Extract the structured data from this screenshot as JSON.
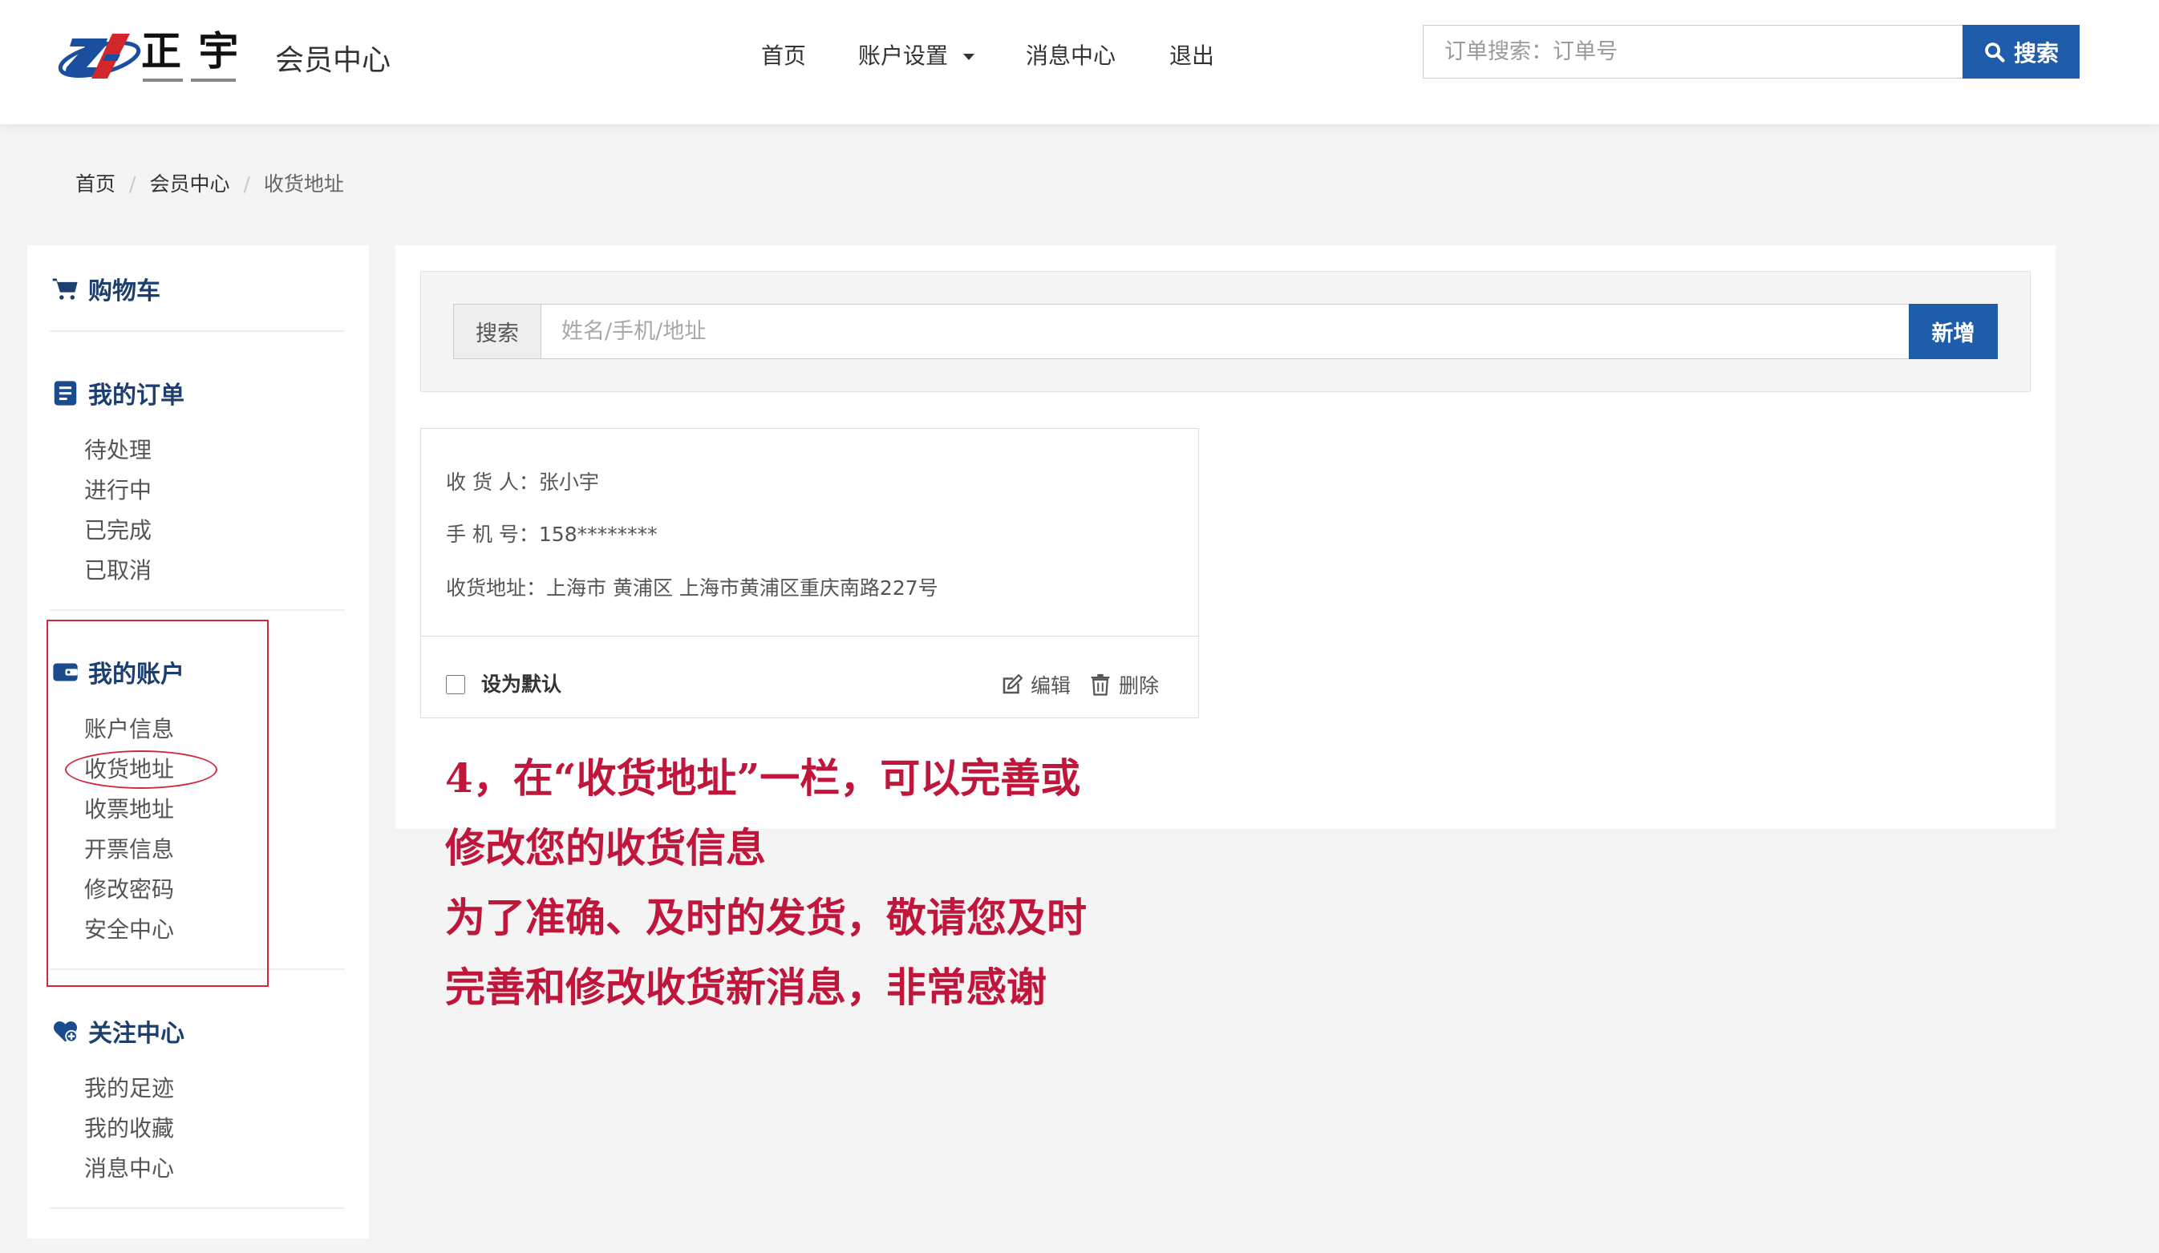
{
  "header": {
    "logo_text": "正 宇",
    "title": "会员中心",
    "nav": [
      {
        "label": "首页"
      },
      {
        "label": "账户设置",
        "icon": "caret-down-icon"
      },
      {
        "label": "消息中心"
      },
      {
        "label": "退出"
      }
    ],
    "search_placeholder": "订单搜索：订单号",
    "search_button": "搜索",
    "search_icon": "search-icon"
  },
  "breadcrumb": [
    "首页",
    "会员中心",
    "收货地址"
  ],
  "sidebar": {
    "sections": [
      {
        "title": "购物车",
        "icon": "cart-icon",
        "items": []
      },
      {
        "title": "我的订单",
        "icon": "order-icon",
        "items": [
          "待处理",
          "进行中",
          "已完成",
          "已取消"
        ]
      },
      {
        "title": "我的账户",
        "icon": "wallet-icon",
        "items": [
          "账户信息",
          "收货地址",
          "收票地址",
          "开票信息",
          "修改密码",
          "安全中心"
        ]
      },
      {
        "title": "关注中心",
        "icon": "heart-icon",
        "items": [
          "我的足迹",
          "我的收藏",
          "消息中心"
        ]
      }
    ],
    "highlighted_item": "收货地址"
  },
  "address_search": {
    "addon_label": "搜索",
    "placeholder": "姓名/手机/地址",
    "add_button": "新增"
  },
  "address_card": {
    "recipient_label": "收 货 人：",
    "recipient": "张小宇",
    "phone_label": "手 机 号：",
    "phone": "158********",
    "address_label": "收货地址：",
    "address": "上海市 黄浦区 上海市黄浦区重庆南路227号",
    "default_label": "设为默认",
    "default_checked": false,
    "edit_label": "编辑",
    "edit_icon": "edit-icon",
    "delete_label": "删除",
    "delete_icon": "trash-icon"
  },
  "annotation": {
    "lines": [
      "4，在“收货地址”一栏，可以完善或",
      "修改您的收货信息",
      "为了准确、及时的发货，敬请您及时",
      "完善和修改收货新消息，非常感谢"
    ]
  },
  "colors": {
    "accent": "#1f5ca9",
    "heading": "#1d3f70",
    "annotation": "#c1163b",
    "highlight": "#d1283c"
  }
}
